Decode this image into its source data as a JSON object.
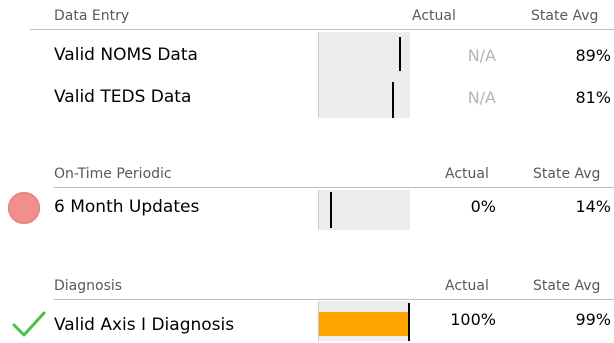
{
  "sections": [
    {
      "title": "Data Entry",
      "actual_header": "Actual",
      "avg_header": "State Avg",
      "rows": [
        {
          "label": "Valid NOMS Data",
          "actual": "N/A",
          "state_avg": "89%",
          "marker_pct": 89
        },
        {
          "label": "Valid TEDS Data",
          "actual": "N/A",
          "state_avg": "81%",
          "marker_pct": 81
        }
      ]
    },
    {
      "title": "On-Time Periodic",
      "actual_header": "Actual",
      "avg_header": "State Avg",
      "rows": [
        {
          "label": "6 Month Updates",
          "actual": "0%",
          "state_avg": "14%",
          "marker_pct": 14,
          "actual_pct": 0,
          "status_icon": "red-circle-icon"
        }
      ]
    },
    {
      "title": "Diagnosis",
      "actual_header": "Actual",
      "avg_header": "State Avg",
      "rows": [
        {
          "label": "Valid Axis I Diagnosis",
          "actual": "100%",
          "state_avg": "99%",
          "marker_pct": 99,
          "actual_pct": 100,
          "status_icon": "green-check-icon"
        }
      ]
    }
  ],
  "colors": {
    "bar_fill": "#ffa500",
    "status_red": "#f0908a",
    "status_green": "#46c346",
    "na_text": "#b4b4b4"
  }
}
